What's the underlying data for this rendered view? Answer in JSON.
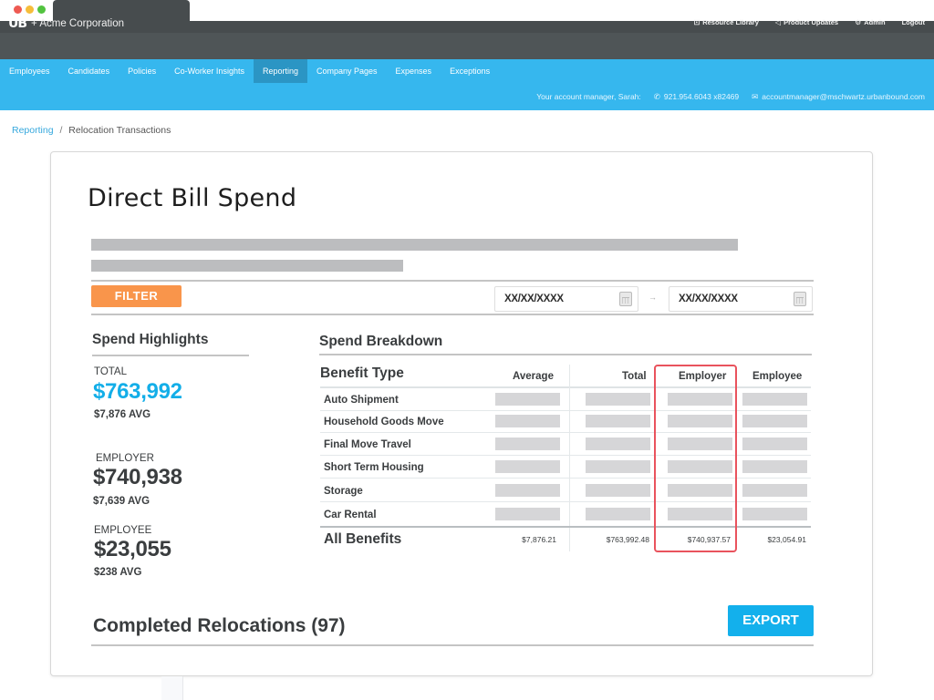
{
  "browser": {
    "window_controls": [
      "close",
      "minimize",
      "maximize"
    ]
  },
  "header": {
    "logo_text": "UB",
    "company": "+ Acme Corporation",
    "links": [
      {
        "icon": "book-icon",
        "glyph": "📖",
        "label": "Resource Library"
      },
      {
        "icon": "megaphone-icon",
        "glyph": "📣",
        "label": "Product Updates"
      },
      {
        "icon": "gear-icon",
        "glyph": "⚙",
        "label": "Admin"
      },
      {
        "icon": "",
        "glyph": "",
        "label": "Logout"
      }
    ]
  },
  "nav": {
    "items": [
      {
        "label": "Employees",
        "active": false
      },
      {
        "label": "Candidates",
        "active": false
      },
      {
        "label": "Policies",
        "active": false
      },
      {
        "label": "Co-Worker Insights",
        "active": false
      },
      {
        "label": "Reporting",
        "active": true
      },
      {
        "label": "Company Pages",
        "active": false
      },
      {
        "label": "Expenses",
        "active": false
      },
      {
        "label": "Exceptions",
        "active": false
      }
    ],
    "account_manager_label": "Your account manager, Sarah:",
    "phone_icon": "✆",
    "phone": "921.954.6043 x82469",
    "email_icon": "✉",
    "email": "accountmanager@mschwartz.urbanbound.com"
  },
  "breadcrumb": {
    "parent": "Reporting",
    "separator": "/",
    "current": "Relocation Transactions"
  },
  "page": {
    "title": "Direct Bill Spend",
    "filter_label": "FILTER",
    "date_from": "XX/XX/XXXX",
    "date_to": "XX/XX/XXXX",
    "date_separator": "→"
  },
  "highlights": {
    "title": "Spend Highlights",
    "total_label": "TOTAL",
    "total_value": "$763,992",
    "total_avg": "$7,876 AVG",
    "employer_label": "EMPLOYER",
    "employer_value": "$740,938",
    "employer_avg": "$7,639 AVG",
    "employee_label": "EMPLOYEE",
    "employee_value": "$23,055",
    "employee_avg": "$238 AVG"
  },
  "breakdown": {
    "title": "Spend Breakdown",
    "columns": [
      "Benefit Type",
      "Average",
      "Total",
      "Employer",
      "Employee"
    ],
    "rows": [
      "Auto Shipment",
      "Household Goods Move",
      "Final Move Travel",
      "Short Term Housing",
      "Storage",
      "Car Rental"
    ],
    "totals": {
      "label": "All Benefits",
      "average": "$7,876.21",
      "total": "$763,992.48",
      "employer": "$740,937.57",
      "employee": "$23,054.91"
    },
    "highlighted_column": "Employer",
    "highlight_color": "#e9535d"
  },
  "completed": {
    "title": "Completed Relocations (97)",
    "export_label": "EXPORT"
  },
  "colors": {
    "nav_blue": "#36b7ee",
    "nav_active": "#2b95c4",
    "accent_blue": "#13aee8",
    "filter_orange": "#f9954b",
    "export_blue": "#13b0ec",
    "topbar": "#4f5557"
  }
}
